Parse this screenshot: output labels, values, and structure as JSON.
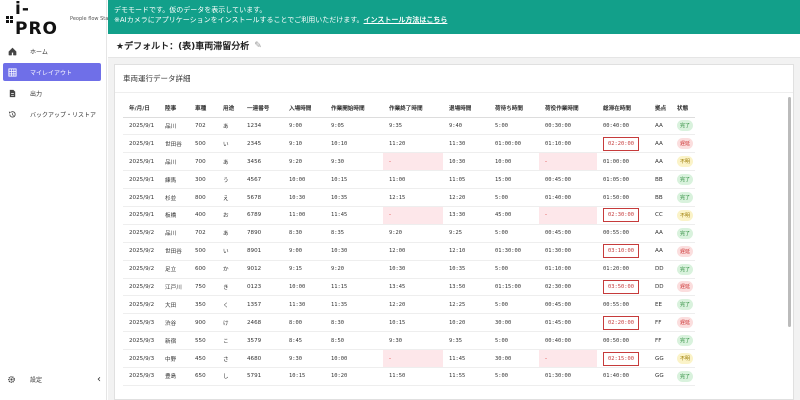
{
  "brand": {
    "logo": "i-PRO",
    "subtitle": "People flow Statistics"
  },
  "sidebar": {
    "items": [
      {
        "label": "ホーム",
        "icon": "home-icon"
      },
      {
        "label": "マイレイアウト",
        "icon": "grid-icon",
        "active": true
      },
      {
        "label": "出力",
        "icon": "file-icon"
      },
      {
        "label": "バックアップ・リストア",
        "icon": "restore-icon"
      }
    ],
    "settings_label": "設定",
    "collapse": "‹"
  },
  "banner": {
    "line1": "デモモードです。仮のデータを表示しています。",
    "line2": "※AIカメラにアプリケーションをインストールすることでご利用いただけます。",
    "link": "インストール方法はこちら"
  },
  "header": {
    "title": "★デフォルト：(表)車両滞留分析"
  },
  "panel": {
    "title": "車両運行データ詳細"
  },
  "table": {
    "headers": [
      "年/月/日",
      "陸事",
      "車種",
      "用途",
      "一連番号",
      "入場時間",
      "作業開始時間",
      "作業終了時間",
      "退場時間",
      "荷待ち時間",
      "荷役作業時間",
      "総滞在時間",
      "拠点",
      "状態"
    ],
    "rows": [
      [
        "2025/9/1",
        "品川",
        "702",
        "あ",
        "1234",
        "9:00",
        "9:05",
        "9:35",
        "9:40",
        "5:00",
        "00:30:00",
        "00:40:00",
        "AA",
        "完了"
      ],
      [
        "2025/9/1",
        "世田谷",
        "500",
        "い",
        "2345",
        "9:10",
        "10:10",
        "11:20",
        "11:30",
        "01:00:00",
        "01:10:00",
        "02:20:00",
        "AA",
        "遅延"
      ],
      [
        "2025/9/1",
        "品川",
        "700",
        "あ",
        "3456",
        "9:20",
        "9:30",
        "-",
        "10:30",
        "10:00",
        "-",
        "01:00:00",
        "AA",
        "不明"
      ],
      [
        "2025/9/1",
        "練馬",
        "300",
        "う",
        "4567",
        "10:00",
        "10:15",
        "11:00",
        "11:05",
        "15:00",
        "00:45:00",
        "01:05:00",
        "BB",
        "完了"
      ],
      [
        "2025/9/1",
        "杉並",
        "800",
        "え",
        "5678",
        "10:30",
        "10:35",
        "12:15",
        "12:20",
        "5:00",
        "01:40:00",
        "01:50:00",
        "BB",
        "完了"
      ],
      [
        "2025/9/1",
        "板橋",
        "400",
        "お",
        "6789",
        "11:00",
        "11:45",
        "-",
        "13:30",
        "45:00",
        "-",
        "02:30:00",
        "CC",
        "不明"
      ],
      [
        "2025/9/2",
        "品川",
        "702",
        "あ",
        "7890",
        "8:30",
        "8:35",
        "9:20",
        "9:25",
        "5:00",
        "00:45:00",
        "00:55:00",
        "AA",
        "完了"
      ],
      [
        "2025/9/2",
        "世田谷",
        "500",
        "い",
        "8901",
        "9:00",
        "10:30",
        "12:00",
        "12:10",
        "01:30:00",
        "01:30:00",
        "03:10:00",
        "AA",
        "遅延"
      ],
      [
        "2025/9/2",
        "足立",
        "600",
        "か",
        "9012",
        "9:15",
        "9:20",
        "10:30",
        "10:35",
        "5:00",
        "01:10:00",
        "01:20:00",
        "DD",
        "完了"
      ],
      [
        "2025/9/2",
        "江戸川",
        "750",
        "き",
        "0123",
        "10:00",
        "11:15",
        "13:45",
        "13:50",
        "01:15:00",
        "02:30:00",
        "03:50:00",
        "DD",
        "遅延"
      ],
      [
        "2025/9/2",
        "大田",
        "350",
        "く",
        "1357",
        "11:30",
        "11:35",
        "12:20",
        "12:25",
        "5:00",
        "00:45:00",
        "00:55:00",
        "EE",
        "完了"
      ],
      [
        "2025/9/3",
        "渋谷",
        "900",
        "け",
        "2468",
        "8:00",
        "8:30",
        "10:15",
        "10:20",
        "30:00",
        "01:45:00",
        "02:20:00",
        "FF",
        "遅延"
      ],
      [
        "2025/9/3",
        "新宿",
        "550",
        "こ",
        "3579",
        "8:45",
        "8:50",
        "9:30",
        "9:35",
        "5:00",
        "00:40:00",
        "00:50:00",
        "FF",
        "完了"
      ],
      [
        "2025/9/3",
        "中野",
        "450",
        "さ",
        "4680",
        "9:30",
        "10:00",
        "-",
        "11:45",
        "30:00",
        "-",
        "02:15:00",
        "GG",
        "不明"
      ],
      [
        "2025/9/3",
        "豊島",
        "650",
        "し",
        "5791",
        "10:15",
        "10:20",
        "11:50",
        "11:55",
        "5:00",
        "01:30:00",
        "01:40:00",
        "GG",
        "完了"
      ]
    ]
  },
  "colors": {
    "banner": "#12a08a",
    "active_nav": "#6f6fe8",
    "over_border": "#c63b3b",
    "missing_bg": "#fde7ea"
  }
}
